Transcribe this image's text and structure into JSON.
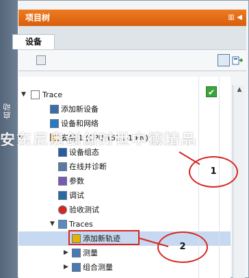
{
  "panel": {
    "title": "项目树",
    "side_tab": "启动",
    "tab": "设备"
  },
  "tree": {
    "items": [
      {
        "label": "Trace",
        "icon": "document-icon",
        "expanded": true
      },
      {
        "label": "添加新设备",
        "icon": "add-device-icon"
      },
      {
        "label": "设备和网络",
        "icon": "network-icon"
      },
      {
        "label": "安装 1 (CPU 1511-1 PN)",
        "icon": "cpu-icon"
      },
      {
        "label": "设备组态",
        "icon": "device-config-icon"
      },
      {
        "label": "在线并诊断",
        "icon": "online-diagnostics-icon"
      },
      {
        "label": "参数",
        "icon": "parameters-icon"
      },
      {
        "label": "调试",
        "icon": "commissioning-icon"
      },
      {
        "label": "验收测试",
        "icon": "acceptance-test-icon"
      },
      {
        "label": "Traces",
        "icon": "traces-folder-icon",
        "expanded": true
      },
      {
        "label": "添加新轨迹",
        "icon": "add-trace-icon",
        "selected": true
      },
      {
        "label": "测量",
        "icon": "measurement-folder-icon"
      },
      {
        "label": "组合测量",
        "icon": "combined-measurement-folder-icon"
      }
    ]
  },
  "watermark": "安东尼奥剑创时世中德精品",
  "callouts": {
    "one": "1",
    "two": "2"
  },
  "colors": {
    "header": "#e2681a",
    "callout": "#d9241f",
    "status_ok": "#3aa53a"
  }
}
